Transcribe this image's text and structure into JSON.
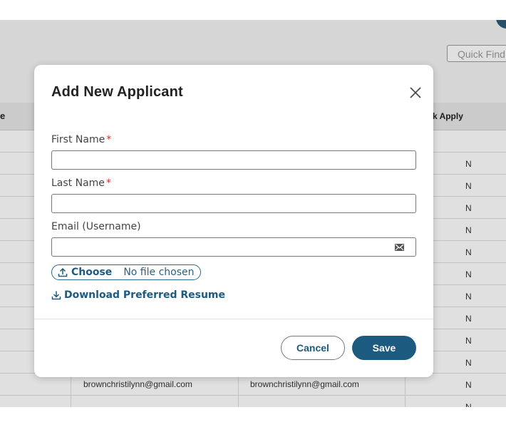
{
  "background": {
    "quick_find_placeholder": "Quick Find",
    "table": {
      "header_left": "e",
      "header_right": "k Apply",
      "rows": [
        {
          "col_a": "",
          "col_b": "",
          "flag": ""
        },
        {
          "col_a": "",
          "col_b": "",
          "flag": "N"
        },
        {
          "col_a": "",
          "col_b": "",
          "flag": "N"
        },
        {
          "col_a": "",
          "col_b": "",
          "flag": "N"
        },
        {
          "col_a": "",
          "col_b": "",
          "flag": "N"
        },
        {
          "col_a": "",
          "col_b": "",
          "flag": "N"
        },
        {
          "col_a": "",
          "col_b": "",
          "flag": "N"
        },
        {
          "col_a": "",
          "col_b": "",
          "flag": "N"
        },
        {
          "col_a": "",
          "col_b": "",
          "flag": "N"
        },
        {
          "col_a": "",
          "col_b": "",
          "flag": "N"
        },
        {
          "col_a": "",
          "col_b": "",
          "flag": "N"
        },
        {
          "col_a": "brownchristilynn@gmail.com",
          "col_b": "brownchristilynn@gmail.com",
          "flag": "N"
        },
        {
          "col_a": "",
          "col_b": "",
          "flag": "N"
        }
      ]
    }
  },
  "modal": {
    "title": "Add New Applicant",
    "close_icon": "close-icon",
    "fields": {
      "first_name": {
        "label": "First Name",
        "required_mark": "*",
        "value": ""
      },
      "last_name": {
        "label": "Last Name",
        "required_mark": "*",
        "value": ""
      },
      "email": {
        "label": "Email (Username)",
        "value": "",
        "icon": "envelope-icon"
      }
    },
    "file_upload": {
      "button_label": "Choose",
      "status_text": "No file chosen",
      "icon": "upload-icon"
    },
    "download_link": {
      "label": "Download Preferred Resume",
      "icon": "download-icon"
    },
    "buttons": {
      "cancel": "Cancel",
      "save": "Save"
    },
    "colors": {
      "primary": "#1d5a80",
      "required": "#c0392b"
    }
  }
}
